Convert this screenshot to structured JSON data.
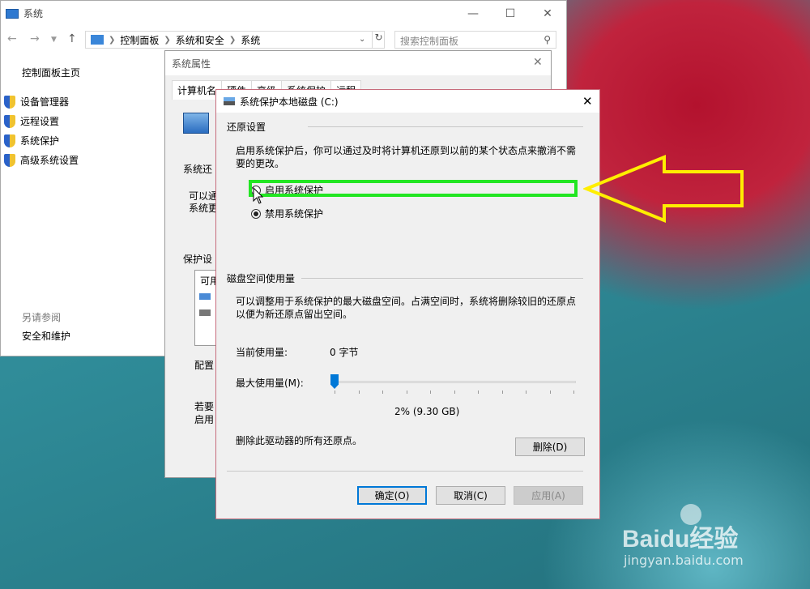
{
  "system_window": {
    "title": "系统",
    "address": {
      "crumbs": [
        "控制面板",
        "系统和安全",
        "系统"
      ]
    },
    "search_placeholder": "搜索控制面板",
    "left_nav": {
      "home": "控制面板主页",
      "items": [
        "设备管理器",
        "远程设置",
        "系统保护",
        "高级系统设置"
      ],
      "see_also_heading": "另请参阅",
      "see_also": [
        "安全和维护"
      ]
    }
  },
  "properties_window": {
    "title": "系统属性",
    "tabs": [
      "计算机名",
      "硬件",
      "高级",
      "系统保护",
      "远程"
    ],
    "partial_texts": [
      "系统还",
      "可以通",
      "系统更",
      "保护设",
      "可用",
      "配置",
      "若要",
      "启用"
    ]
  },
  "dialog": {
    "title": "系统保护本地磁盘 (C:)",
    "restore_heading": "还原设置",
    "restore_description": "启用系统保护后，你可以通过及时将计算机还原到以前的某个状态点来撤消不需要的更改。",
    "options": [
      {
        "label": "启用系统保护",
        "selected": false
      },
      {
        "label": "禁用系统保护",
        "selected": true
      }
    ],
    "disk_heading": "磁盘空间使用量",
    "disk_description": "可以调整用于系统保护的最大磁盘空间。占满空间时，系统将删除较旧的还原点以便为新还原点留出空间。",
    "current_usage_label": "当前使用量:",
    "current_usage_value": "0 字节",
    "max_usage_label": "最大使用量(M):",
    "max_usage_fraction": 0.02,
    "max_usage_value": "2% (9.30 GB)",
    "delete_text": "删除此驱动器的所有还原点。",
    "buttons": {
      "delete": "删除(D)",
      "ok": "确定(O)",
      "cancel": "取消(C)",
      "apply": "应用(A)"
    }
  },
  "watermark": {
    "brand": "Baidu经验",
    "url": "jingyan.baidu.com"
  },
  "colors": {
    "highlight_box": "#22e622",
    "arrow": "#ffee00",
    "accent": "#0078d7"
  }
}
